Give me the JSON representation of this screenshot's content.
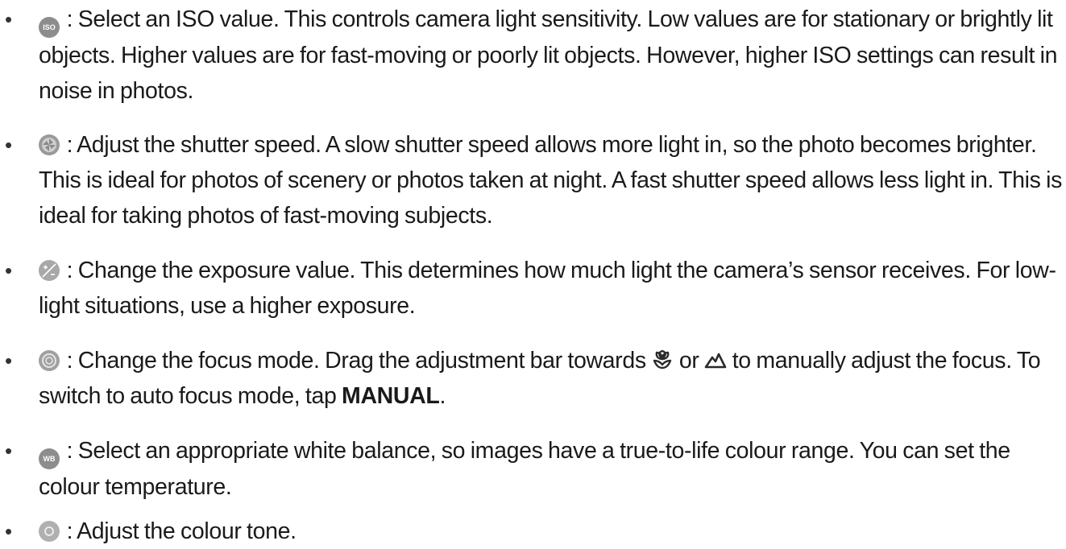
{
  "bullet_char": "•",
  "items": [
    {
      "icon": "iso-icon",
      "icon_text": "ISO",
      "text": ": Select an ISO value. This controls camera light sensitivity. Low values are for stationary or brightly lit objects. Higher values are for fast-moving or poorly lit objects. However, higher ISO settings can result in noise in photos."
    },
    {
      "icon": "shutter-speed-icon",
      "text": ": Adjust the shutter speed. A slow shutter speed allows more light in, so the photo becomes brighter. This is ideal for photos of scenery or photos taken at night. A fast shutter speed allows less light in. This is ideal for taking photos of fast-moving subjects."
    },
    {
      "icon": "exposure-value-icon",
      "text": ": Change the exposure value. This determines how much light the camera’s sensor receives. For low-light situations, use a higher exposure."
    },
    {
      "icon": "focus-mode-icon",
      "text_part1": ": Change the focus mode. Drag the adjustment bar towards",
      "text_or": "or",
      "text_part2": "to manually adjust the focus. To switch to auto focus mode, tap",
      "text_bold": "MANUAL",
      "text_end": ".",
      "inline_icon_1": "macro-flower-icon",
      "inline_icon_2": "mountain-icon"
    },
    {
      "icon": "white-balance-icon",
      "icon_text": "WB",
      "text": ": Select an appropriate white balance, so images have a true-to-life colour range. You can set the colour temperature."
    },
    {
      "icon": "colour-tone-icon",
      "text": ": Adjust the colour tone."
    }
  ],
  "colors": {
    "text": "#1a1a1a",
    "icon_grey": "#8d8d8d"
  }
}
